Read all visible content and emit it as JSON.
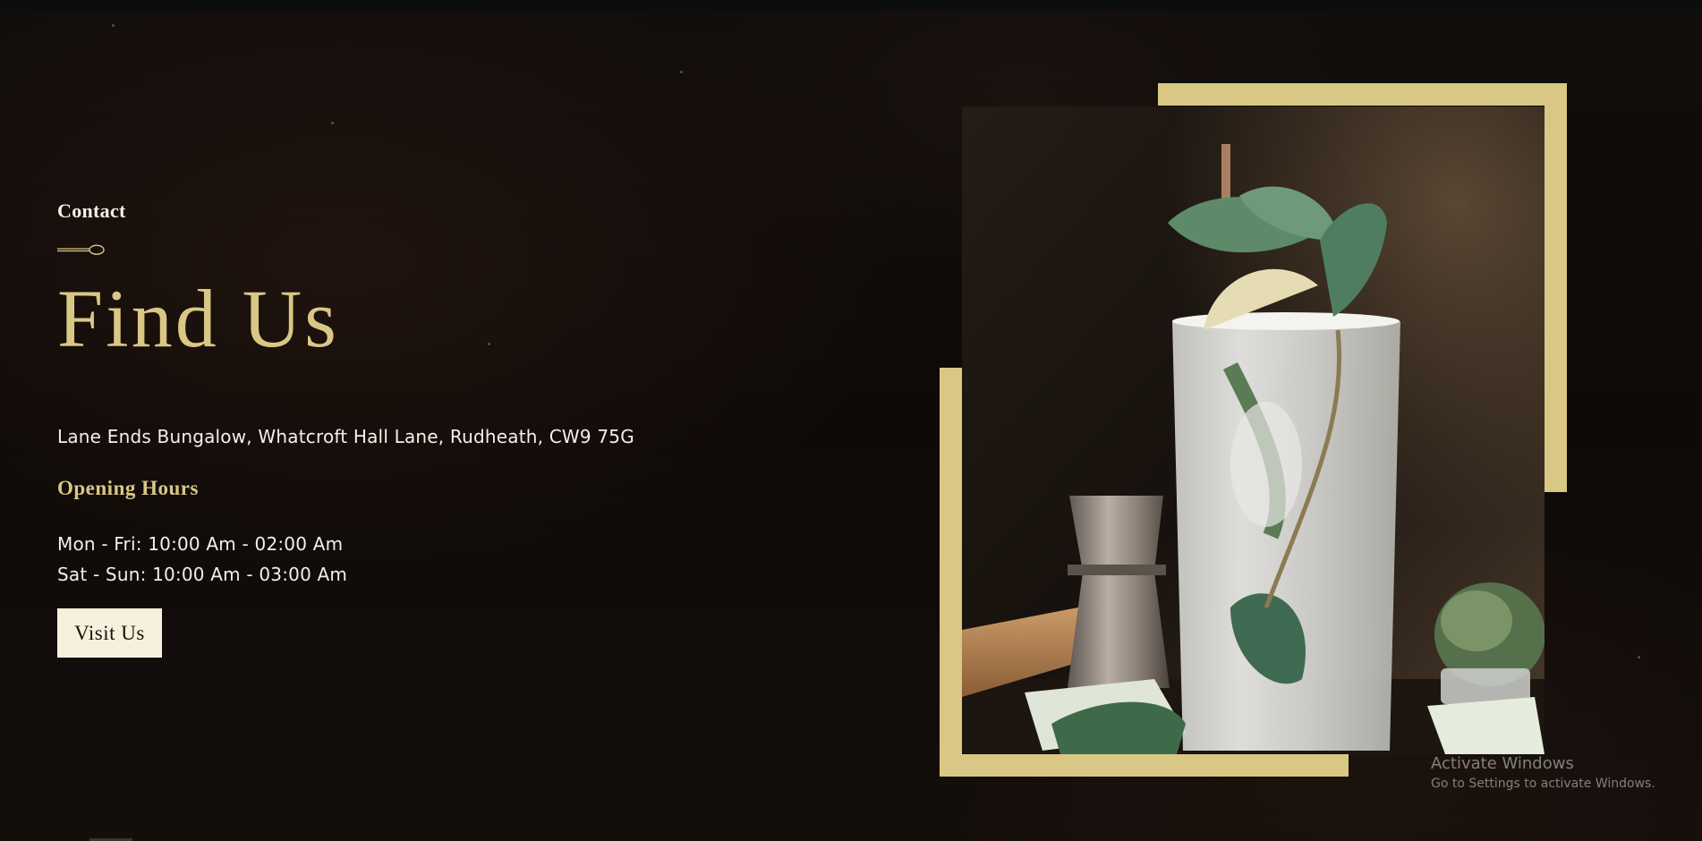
{
  "section": {
    "eyebrow": "Contact",
    "title": "Find Us",
    "address": "Lane Ends Bungalow, Whatcroft Hall Lane, Rudheath, CW9 75G",
    "hours_heading": "Opening Hours",
    "hours": [
      "Mon - Fri: 10:00 Am - 02:00 Am",
      "Sat - Sun: 10:00 Am - 03:00 Am"
    ],
    "cta_label": "Visit Us"
  },
  "image": {
    "alt": "Mojito cocktail with mint, lime and cocktail jigger"
  },
  "watermark": {
    "title": "Activate Windows",
    "subtitle": "Go to Settings to activate Windows."
  },
  "icons": {
    "divider": "spoon-divider-icon"
  },
  "colors": {
    "gold": "#d9c785",
    "cream": "#f7f0dc",
    "background": "#0f0a08"
  }
}
